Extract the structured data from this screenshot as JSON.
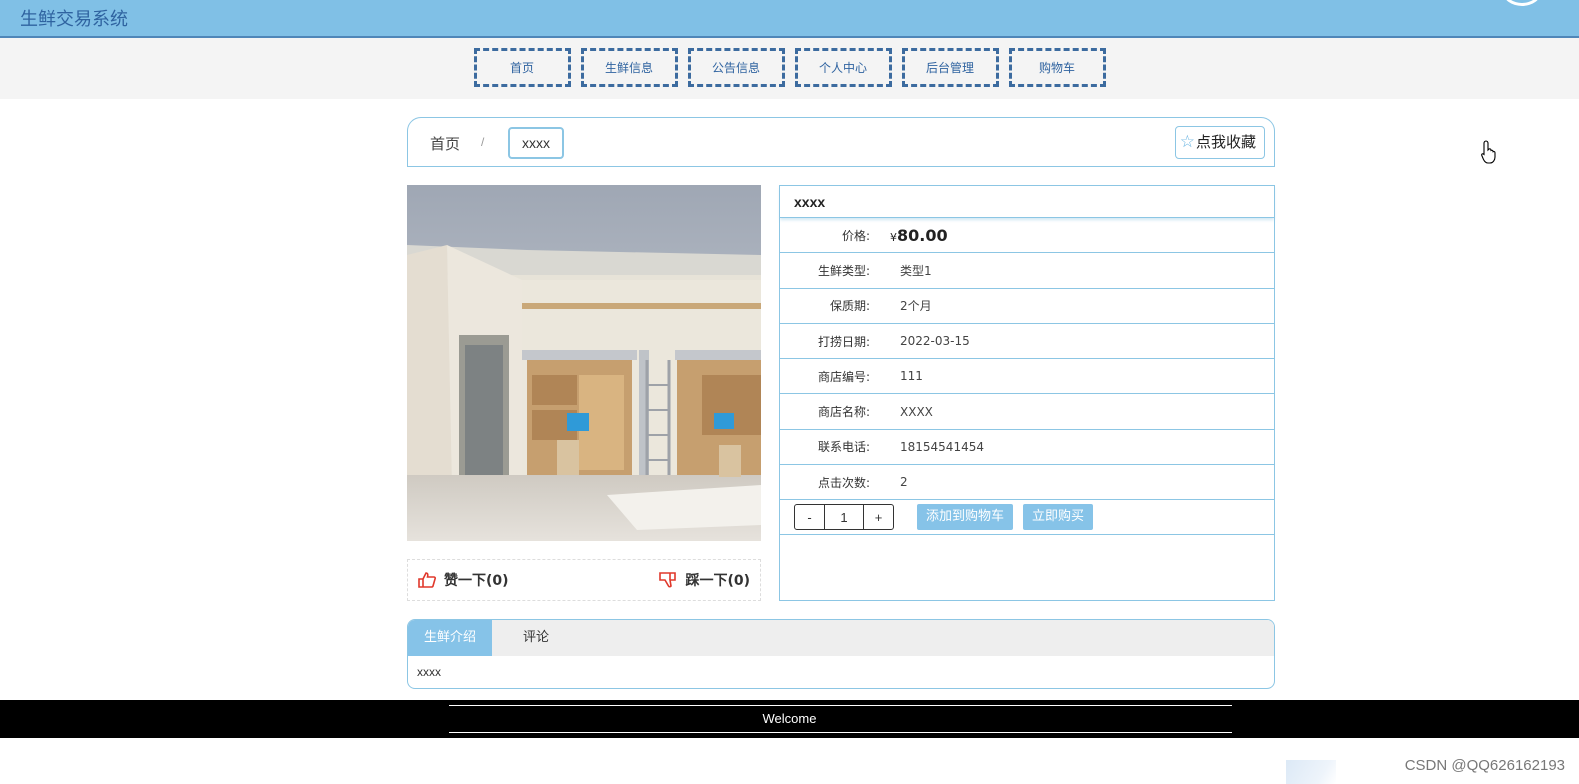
{
  "header": {
    "app_title": "生鲜交易系统"
  },
  "nav": [
    {
      "label": "首页"
    },
    {
      "label": "生鲜信息"
    },
    {
      "label": "公告信息"
    },
    {
      "label": "个人中心"
    },
    {
      "label": "后台管理"
    },
    {
      "label": "购物车"
    }
  ],
  "breadcrumb": {
    "home": "首页",
    "separator": "/",
    "current": "xxxx"
  },
  "favorite_button": {
    "label": "点我收藏",
    "icon": "star-icon"
  },
  "product": {
    "name": "xxxx",
    "image_alt": "dormitory room",
    "price_label": "价格:",
    "currency": "¥",
    "price": "80.00",
    "fields": [
      {
        "label": "生鲜类型:",
        "value": "类型1"
      },
      {
        "label": "保质期:",
        "value": "2个月"
      },
      {
        "label": "打捞日期:",
        "value": "2022-03-15"
      },
      {
        "label": "商店编号:",
        "value": "111"
      },
      {
        "label": "商店名称:",
        "value": "XXXX"
      },
      {
        "label": "联系电话:",
        "value": "18154541454"
      },
      {
        "label": "点击次数:",
        "value": "2"
      }
    ]
  },
  "quantity": {
    "minus": "-",
    "value": "1",
    "plus": "+"
  },
  "actions": {
    "add_to_cart": "添加到购物车",
    "buy_now": "立即购买"
  },
  "votes": {
    "like": "赞一下(0)",
    "dislike": "踩一下(0)"
  },
  "tabs": {
    "items": [
      {
        "label": "生鲜介绍"
      },
      {
        "label": "评论"
      }
    ],
    "active_index": 0,
    "content": "xxxx"
  },
  "footer": {
    "text": "Welcome"
  },
  "watermark": "CSDN @QQ626162193",
  "colors": {
    "header_bg": "#80c0e6",
    "accent": "#86c3e8",
    "nav_border": "#3c6b9f",
    "footer_bg": "#000000"
  }
}
